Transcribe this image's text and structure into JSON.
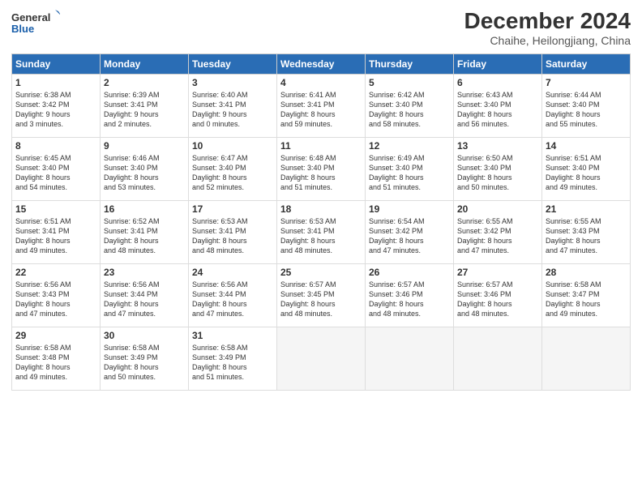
{
  "logo": {
    "line1": "General",
    "line2": "Blue"
  },
  "title": "December 2024",
  "location": "Chaihe, Heilongjiang, China",
  "days_of_week": [
    "Sunday",
    "Monday",
    "Tuesday",
    "Wednesday",
    "Thursday",
    "Friday",
    "Saturday"
  ],
  "weeks": [
    [
      {
        "day": 1,
        "info": "Sunrise: 6:38 AM\nSunset: 3:42 PM\nDaylight: 9 hours\nand 3 minutes."
      },
      {
        "day": 2,
        "info": "Sunrise: 6:39 AM\nSunset: 3:41 PM\nDaylight: 9 hours\nand 2 minutes."
      },
      {
        "day": 3,
        "info": "Sunrise: 6:40 AM\nSunset: 3:41 PM\nDaylight: 9 hours\nand 0 minutes."
      },
      {
        "day": 4,
        "info": "Sunrise: 6:41 AM\nSunset: 3:41 PM\nDaylight: 8 hours\nand 59 minutes."
      },
      {
        "day": 5,
        "info": "Sunrise: 6:42 AM\nSunset: 3:40 PM\nDaylight: 8 hours\nand 58 minutes."
      },
      {
        "day": 6,
        "info": "Sunrise: 6:43 AM\nSunset: 3:40 PM\nDaylight: 8 hours\nand 56 minutes."
      },
      {
        "day": 7,
        "info": "Sunrise: 6:44 AM\nSunset: 3:40 PM\nDaylight: 8 hours\nand 55 minutes."
      }
    ],
    [
      {
        "day": 8,
        "info": "Sunrise: 6:45 AM\nSunset: 3:40 PM\nDaylight: 8 hours\nand 54 minutes."
      },
      {
        "day": 9,
        "info": "Sunrise: 6:46 AM\nSunset: 3:40 PM\nDaylight: 8 hours\nand 53 minutes."
      },
      {
        "day": 10,
        "info": "Sunrise: 6:47 AM\nSunset: 3:40 PM\nDaylight: 8 hours\nand 52 minutes."
      },
      {
        "day": 11,
        "info": "Sunrise: 6:48 AM\nSunset: 3:40 PM\nDaylight: 8 hours\nand 51 minutes."
      },
      {
        "day": 12,
        "info": "Sunrise: 6:49 AM\nSunset: 3:40 PM\nDaylight: 8 hours\nand 51 minutes."
      },
      {
        "day": 13,
        "info": "Sunrise: 6:50 AM\nSunset: 3:40 PM\nDaylight: 8 hours\nand 50 minutes."
      },
      {
        "day": 14,
        "info": "Sunrise: 6:51 AM\nSunset: 3:40 PM\nDaylight: 8 hours\nand 49 minutes."
      }
    ],
    [
      {
        "day": 15,
        "info": "Sunrise: 6:51 AM\nSunset: 3:41 PM\nDaylight: 8 hours\nand 49 minutes."
      },
      {
        "day": 16,
        "info": "Sunrise: 6:52 AM\nSunset: 3:41 PM\nDaylight: 8 hours\nand 48 minutes."
      },
      {
        "day": 17,
        "info": "Sunrise: 6:53 AM\nSunset: 3:41 PM\nDaylight: 8 hours\nand 48 minutes."
      },
      {
        "day": 18,
        "info": "Sunrise: 6:53 AM\nSunset: 3:41 PM\nDaylight: 8 hours\nand 48 minutes."
      },
      {
        "day": 19,
        "info": "Sunrise: 6:54 AM\nSunset: 3:42 PM\nDaylight: 8 hours\nand 47 minutes."
      },
      {
        "day": 20,
        "info": "Sunrise: 6:55 AM\nSunset: 3:42 PM\nDaylight: 8 hours\nand 47 minutes."
      },
      {
        "day": 21,
        "info": "Sunrise: 6:55 AM\nSunset: 3:43 PM\nDaylight: 8 hours\nand 47 minutes."
      }
    ],
    [
      {
        "day": 22,
        "info": "Sunrise: 6:56 AM\nSunset: 3:43 PM\nDaylight: 8 hours\nand 47 minutes."
      },
      {
        "day": 23,
        "info": "Sunrise: 6:56 AM\nSunset: 3:44 PM\nDaylight: 8 hours\nand 47 minutes."
      },
      {
        "day": 24,
        "info": "Sunrise: 6:56 AM\nSunset: 3:44 PM\nDaylight: 8 hours\nand 47 minutes."
      },
      {
        "day": 25,
        "info": "Sunrise: 6:57 AM\nSunset: 3:45 PM\nDaylight: 8 hours\nand 48 minutes."
      },
      {
        "day": 26,
        "info": "Sunrise: 6:57 AM\nSunset: 3:46 PM\nDaylight: 8 hours\nand 48 minutes."
      },
      {
        "day": 27,
        "info": "Sunrise: 6:57 AM\nSunset: 3:46 PM\nDaylight: 8 hours\nand 48 minutes."
      },
      {
        "day": 28,
        "info": "Sunrise: 6:58 AM\nSunset: 3:47 PM\nDaylight: 8 hours\nand 49 minutes."
      }
    ],
    [
      {
        "day": 29,
        "info": "Sunrise: 6:58 AM\nSunset: 3:48 PM\nDaylight: 8 hours\nand 49 minutes."
      },
      {
        "day": 30,
        "info": "Sunrise: 6:58 AM\nSunset: 3:49 PM\nDaylight: 8 hours\nand 50 minutes."
      },
      {
        "day": 31,
        "info": "Sunrise: 6:58 AM\nSunset: 3:49 PM\nDaylight: 8 hours\nand 51 minutes."
      },
      null,
      null,
      null,
      null
    ]
  ]
}
